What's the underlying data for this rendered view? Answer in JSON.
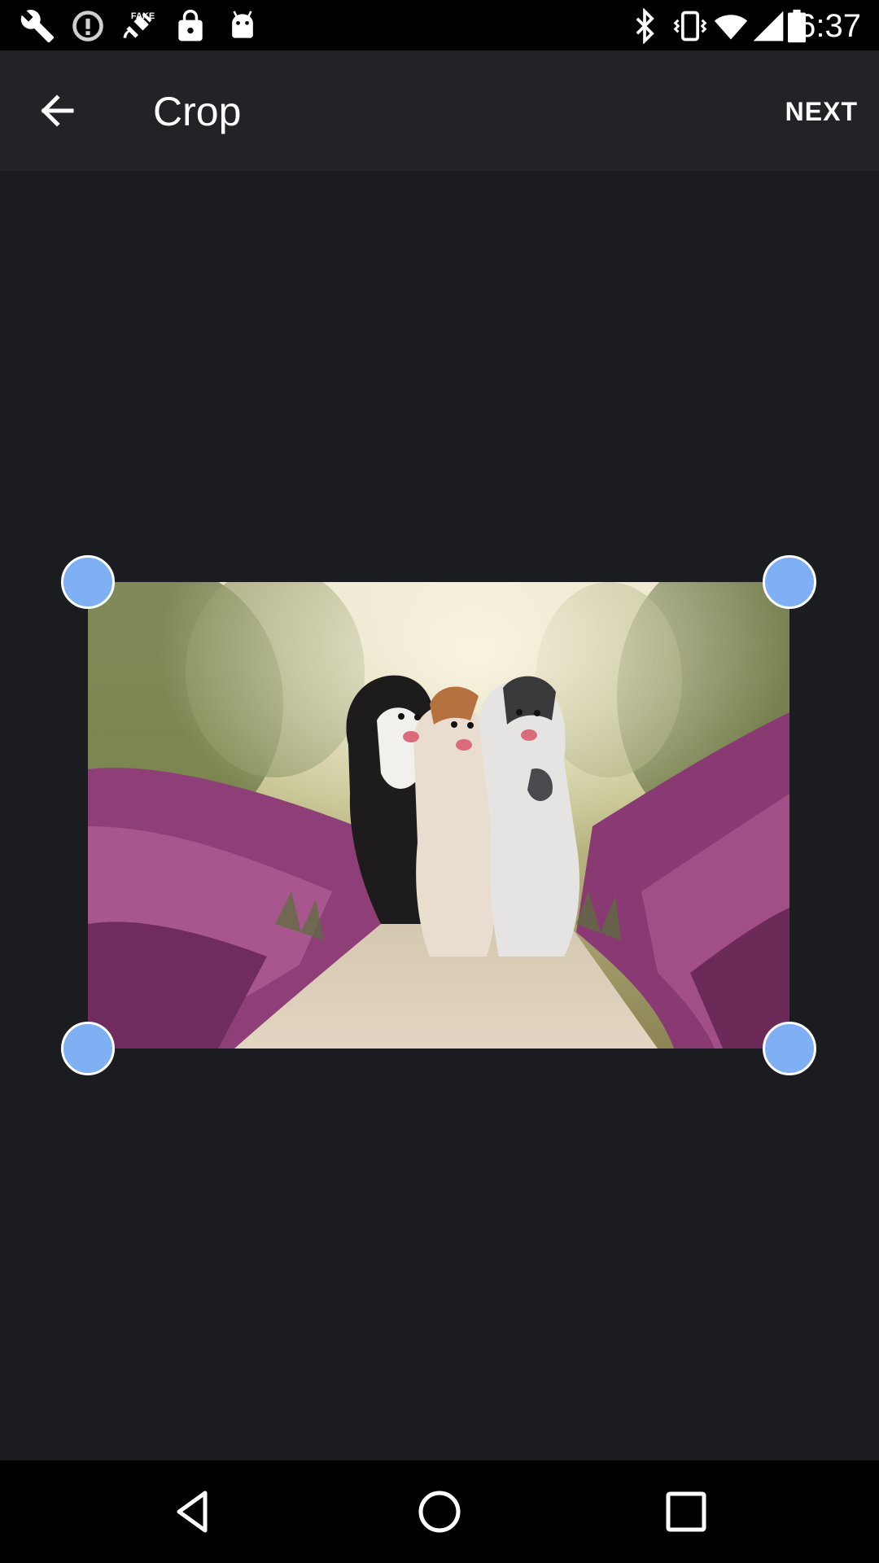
{
  "status_bar": {
    "time": "6:37",
    "left_icons": [
      "wrench-icon",
      "data-saver-icon",
      "fake-gps-icon",
      "lock-icon",
      "android-icon"
    ],
    "right_icons": [
      "bluetooth-icon",
      "vibrate-icon",
      "wifi-icon",
      "signal-icon",
      "battery-icon"
    ]
  },
  "app_bar": {
    "back_icon": "back-arrow-icon",
    "title": "Crop",
    "next_label": "NEXT"
  },
  "crop": {
    "handle_color": "#7fb0f4",
    "image_subject": "three-dogs-in-heather-field"
  },
  "nav_bar": {
    "icons": [
      "back-triangle-icon",
      "home-circle-icon",
      "recents-square-icon"
    ]
  }
}
